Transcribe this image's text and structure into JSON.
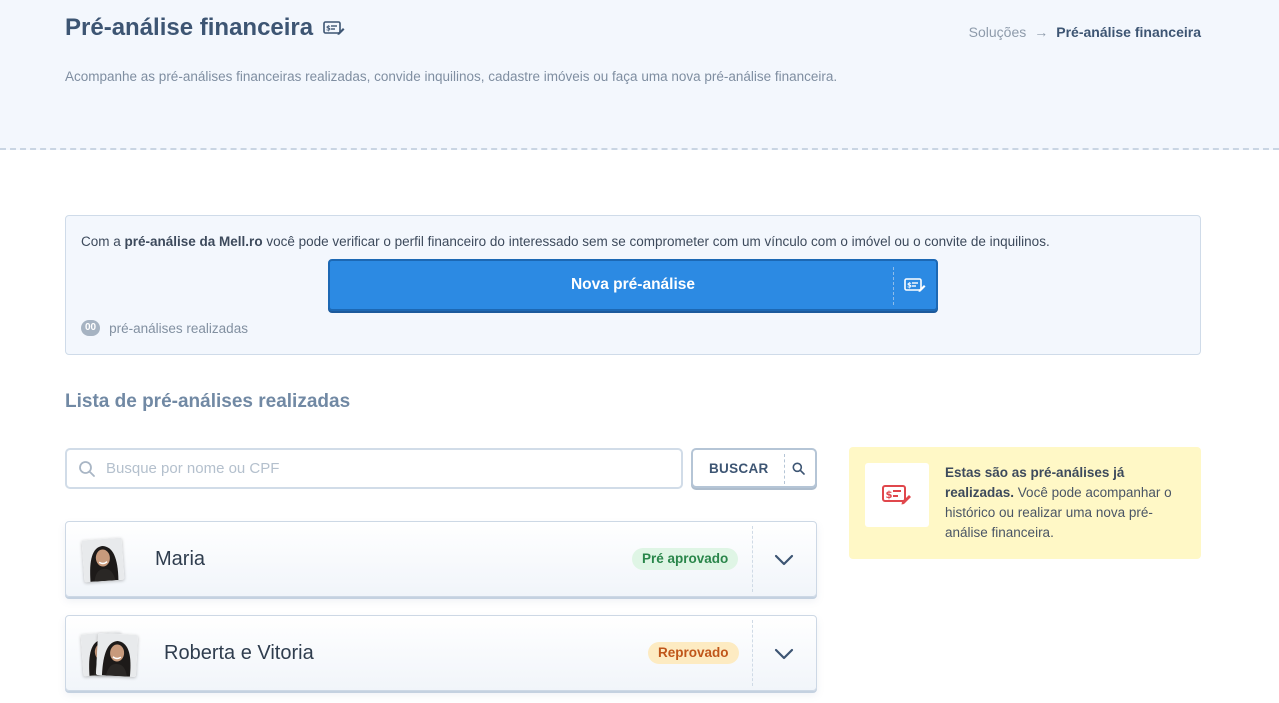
{
  "header": {
    "title": "Pré-análise financeira",
    "subtitle": "Acompanhe as pré-análises financeiras realizadas, convide inquilinos, cadastre imóveis ou faça uma nova pré-análise financeira.",
    "breadcrumb": {
      "parent": "Soluções",
      "arrow": "→",
      "current": "Pré-análise financeira"
    }
  },
  "info": {
    "text_prefix": "Com a ",
    "text_bold": "pré-análise da Mell.ro",
    "text_suffix": " você pode verificar o perfil financeiro do interessado sem se comprometer com um vínculo com o imóvel ou o convite de inquilinos.",
    "new_button_label": "Nova pré-análise",
    "count_badge": "00",
    "count_label": "pré-análises realizadas"
  },
  "list": {
    "title": "Lista de pré-análises realizadas",
    "search_placeholder": "Busque por nome ou CPF",
    "search_value": "",
    "search_button_label": "BUSCAR",
    "items": [
      {
        "name": "Maria",
        "status": "Pré aprovado",
        "status_type": "approved"
      },
      {
        "name": "Roberta e Vitoria",
        "status": "Reprovado",
        "status_type": "rejected"
      }
    ]
  },
  "tip": {
    "bold": "Estas são as pré-análises já realizadas.",
    "text": " Você pode acompanhar o histórico ou realizar uma nova pré-análise financeira."
  },
  "colors": {
    "primary_button": "#2c8ae3",
    "title": "#3d5573",
    "header_bg": "#f3f7fd",
    "tip_bg": "#fff8c6",
    "approved_bg": "#dff5e5",
    "approved_text": "#29864a",
    "rejected_bg": "#fdebc2",
    "rejected_text": "#c0561a"
  },
  "icons": {
    "title": "money-form-icon",
    "breadcrumb_arrow": "arrow-right-icon",
    "new_button": "money-form-icon",
    "search": "search-icon",
    "card_toggle": "chevron-down-icon",
    "tip": "money-form-icon"
  }
}
